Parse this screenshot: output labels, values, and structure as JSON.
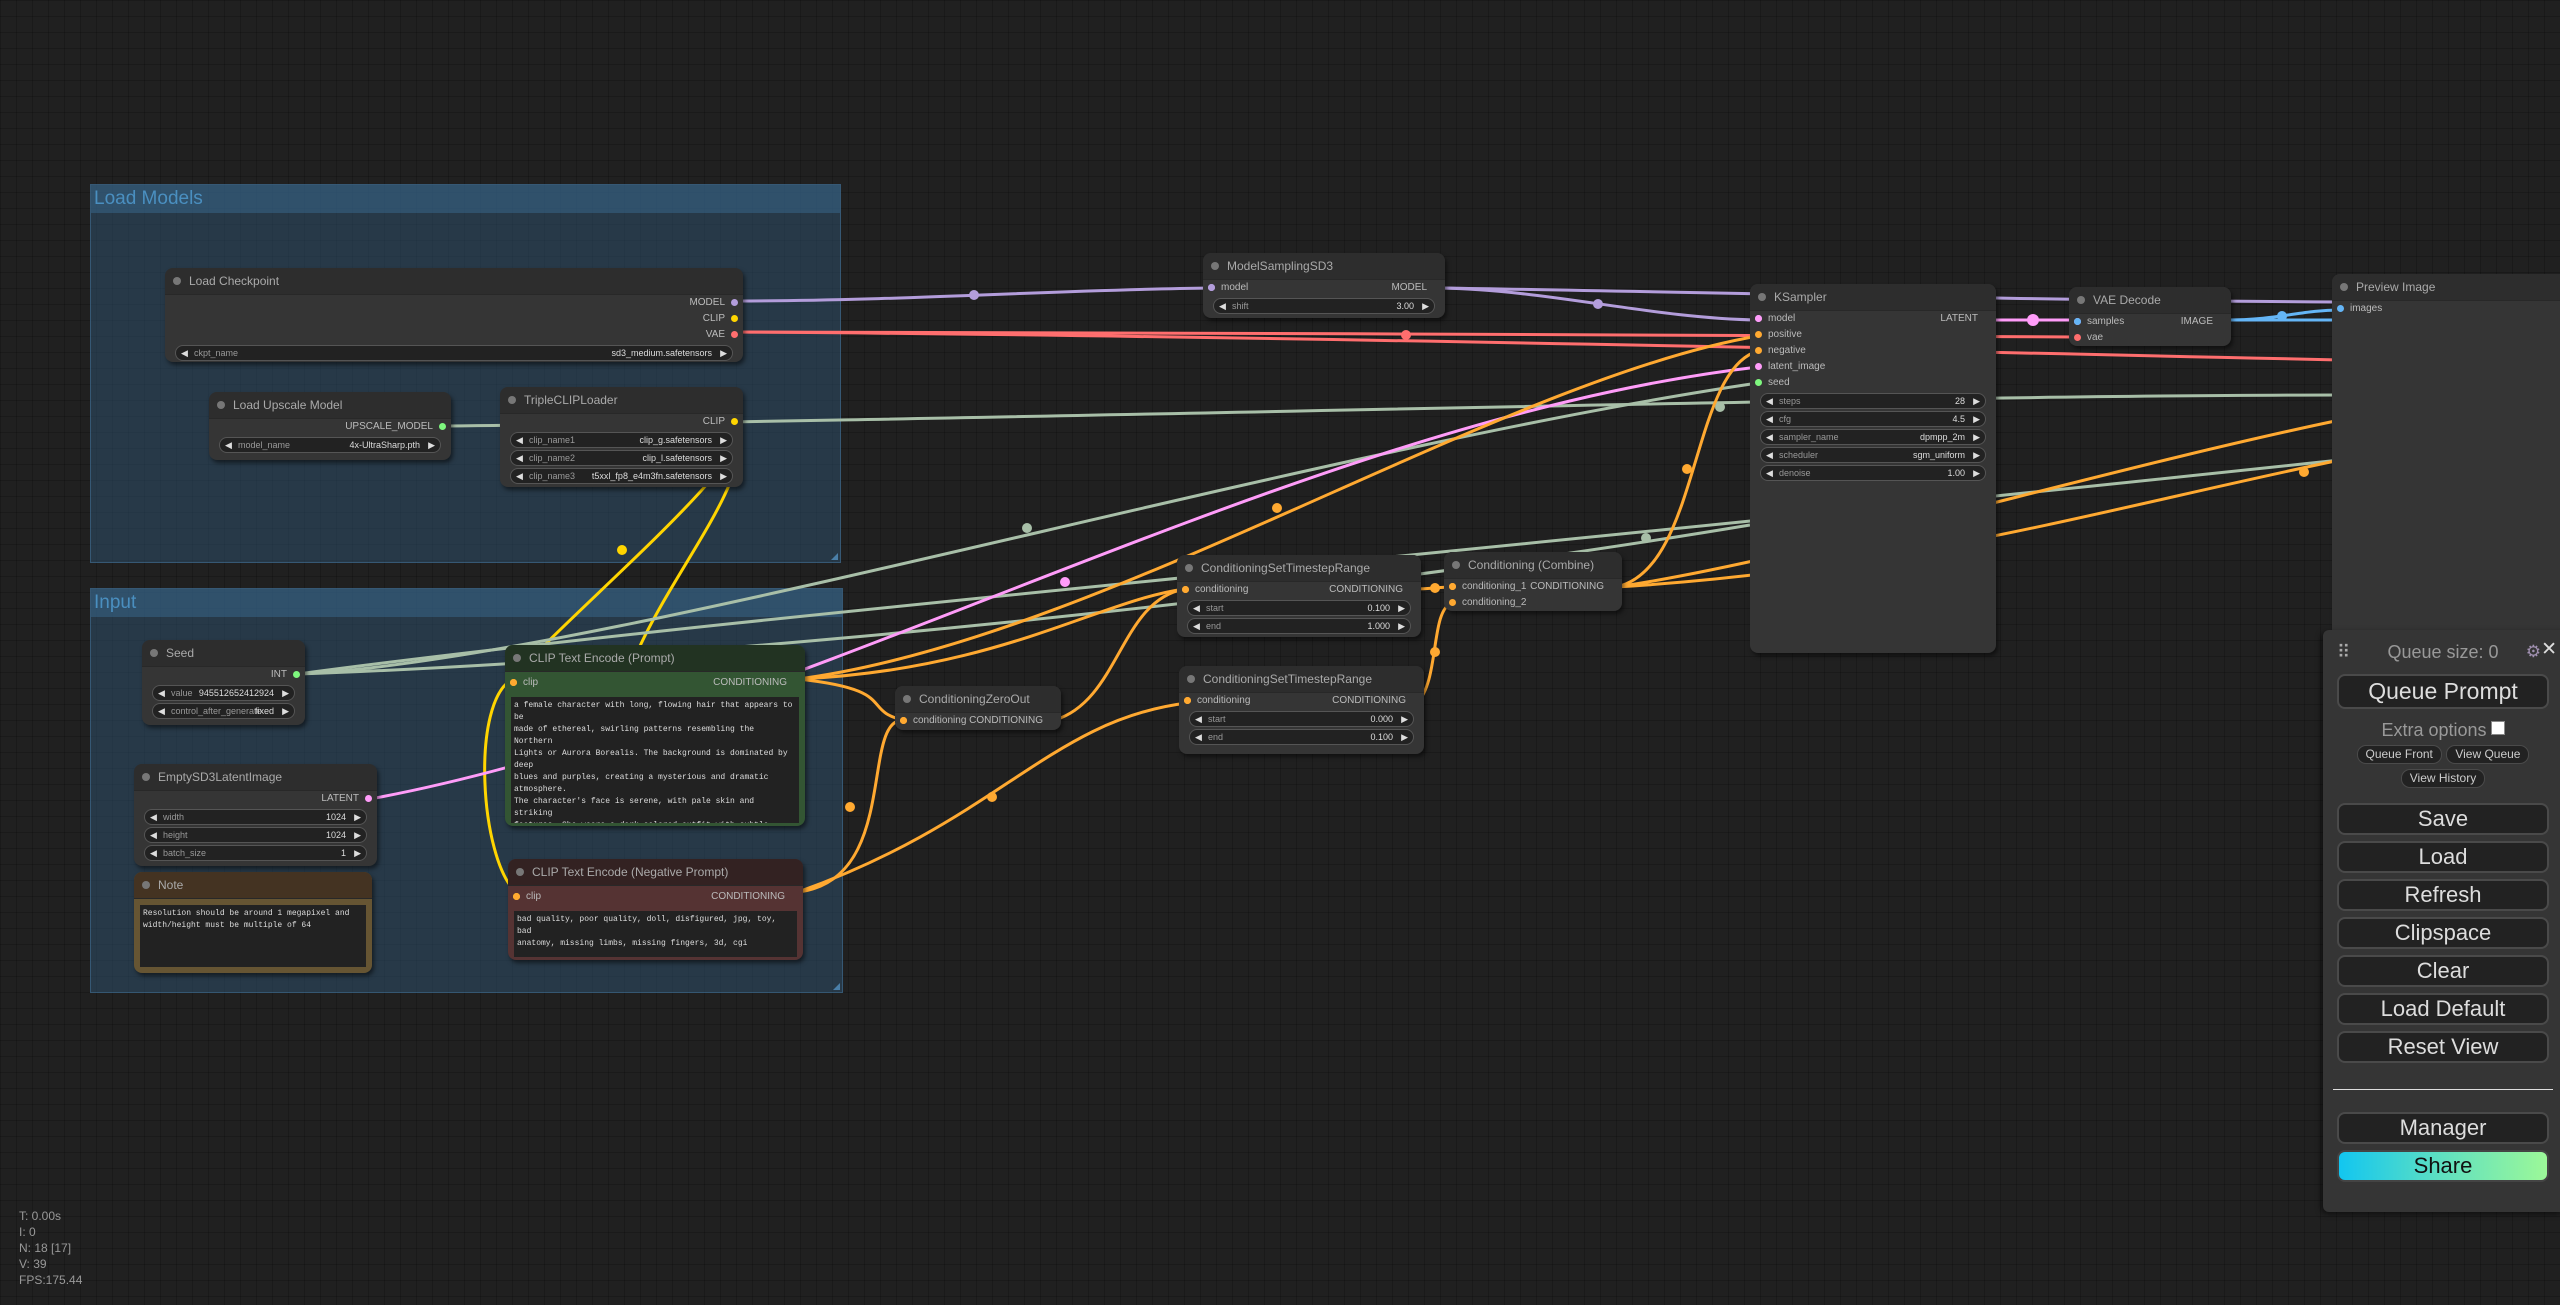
{
  "groups": {
    "load_models": "Load Models",
    "input": "Input"
  },
  "nodes": {
    "load_checkpoint": {
      "title": "Load Checkpoint",
      "outputs": [
        "MODEL",
        "CLIP",
        "VAE"
      ],
      "ckpt_name_label": "ckpt_name",
      "ckpt_name_value": "sd3_medium.safetensors"
    },
    "load_upscale_model": {
      "title": "Load Upscale Model",
      "output": "UPSCALE_MODEL",
      "model_name_label": "model_name",
      "model_name_value": "4x-UltraSharp.pth"
    },
    "triple_clip_loader": {
      "title": "TripleCLIPLoader",
      "output": "CLIP",
      "clip_name1_label": "clip_name1",
      "clip_name1_value": "clip_g.safetensors",
      "clip_name2_label": "clip_name2",
      "clip_name2_value": "clip_l.safetensors",
      "clip_name3_label": "clip_name3",
      "clip_name3_value": "t5xxl_fp8_e4m3fn.safetensors"
    },
    "seed": {
      "title": "Seed",
      "output": "INT",
      "value_label": "value",
      "value": "945512652412924",
      "control_label": "control_after_generate",
      "control_value": "fixed"
    },
    "empty_latent": {
      "title": "EmptySD3LatentImage",
      "output": "LATENT",
      "width_label": "width",
      "width_value": "1024",
      "height_label": "height",
      "height_value": "1024",
      "batch_label": "batch_size",
      "batch_value": "1"
    },
    "note": {
      "title": "Note",
      "text": "Resolution should be around 1 megapixel and\nwidth/height must be multiple of 64"
    },
    "clip_pos": {
      "title": "CLIP Text Encode (Prompt)",
      "input": "clip",
      "output": "CONDITIONING",
      "text": "a female character with long, flowing hair that appears to be\nmade of ethereal, swirling patterns resembling the Northern\nLights or Aurora Borealis. The background is dominated by deep\nblues and purples, creating a mysterious and dramatic atmosphere.\nThe character's face is serene, with pale skin and striking\nfeatures. She wears a dark-colored outfit with subtle patterns.\nThe overall style of the artwork is reminiscent of fantasy or\nsupernatural genres"
    },
    "clip_neg": {
      "title": "CLIP Text Encode (Negative Prompt)",
      "input": "clip",
      "output": "CONDITIONING",
      "text": "bad quality, poor quality, doll, disfigured, jpg, toy, bad\nanatomy, missing limbs, missing fingers, 3d, cgi"
    },
    "zero_out": {
      "title": "ConditioningZeroOut",
      "input": "conditioning",
      "output": "CONDITIONING"
    },
    "model_sampling": {
      "title": "ModelSamplingSD3",
      "input": "model",
      "output": "MODEL",
      "shift_label": "shift",
      "shift_value": "3.00"
    },
    "cstr1": {
      "title": "ConditioningSetTimestepRange",
      "input": "conditioning",
      "output": "CONDITIONING",
      "start_label": "start",
      "start_value": "0.100",
      "end_label": "end",
      "end_value": "1.000"
    },
    "cstr2": {
      "title": "ConditioningSetTimestepRange",
      "input": "conditioning",
      "output": "CONDITIONING",
      "start_label": "start",
      "start_value": "0.000",
      "end_label": "end",
      "end_value": "0.100"
    },
    "combine": {
      "title": "Conditioning (Combine)",
      "input1": "conditioning_1",
      "input2": "conditioning_2",
      "output": "CONDITIONING"
    },
    "ksampler": {
      "title": "KSampler",
      "inputs": [
        "model",
        "positive",
        "negative",
        "latent_image",
        "seed"
      ],
      "output": "LATENT",
      "steps_label": "steps",
      "steps_value": "28",
      "cfg_label": "cfg",
      "cfg_value": "4.5",
      "sampler_label": "sampler_name",
      "sampler_value": "dpmpp_2m",
      "scheduler_label": "scheduler",
      "scheduler_value": "sgm_uniform",
      "denoise_label": "denoise",
      "denoise_value": "1.00"
    },
    "vae_decode": {
      "title": "VAE Decode",
      "input1": "samples",
      "input2": "vae",
      "output": "IMAGE"
    },
    "preview": {
      "title": "Preview Image",
      "input": "images"
    }
  },
  "colors": {
    "model": "#b39ddb",
    "clip": "#ffd500",
    "vae": "#ff6e6e",
    "conditioning": "#ffa931",
    "latent": "#ff9cf9",
    "int": "#7ef77e",
    "image": "#64b5f6",
    "upscale": "#a8bfa8"
  },
  "panel": {
    "queue_size": "Queue size: 0",
    "queue_prompt": "Queue Prompt",
    "extra_options": "Extra options",
    "queue_front": "Queue Front",
    "view_queue": "View Queue",
    "view_history": "View History",
    "save": "Save",
    "load": "Load",
    "refresh": "Refresh",
    "clipspace": "Clipspace",
    "clear": "Clear",
    "load_default": "Load Default",
    "reset_view": "Reset View",
    "manager": "Manager",
    "share": "Share"
  },
  "stats": {
    "t": "T: 0.00s",
    "i": "I: 0",
    "n": "N: 18 [17]",
    "v": "V: 39",
    "fps": "FPS:175.44"
  }
}
